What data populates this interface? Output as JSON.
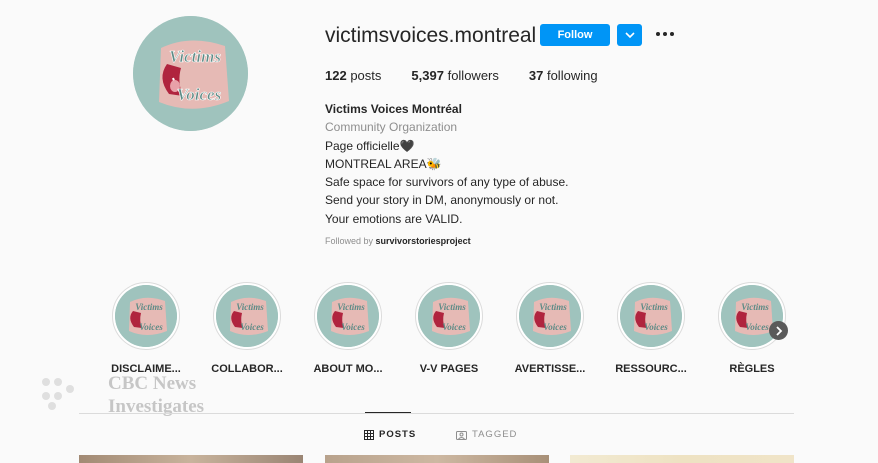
{
  "profile": {
    "username": "victimsvoices.montreal",
    "follow_label": "Follow",
    "avatar_text_top": "Victims",
    "avatar_text_bottom": "Voices",
    "stats": {
      "posts_count": "122",
      "posts_label": "posts",
      "followers_count": "5,397",
      "followers_label": "followers",
      "following_count": "37",
      "following_label": "following"
    },
    "bio": {
      "name": "Victims Voices Montréal",
      "category": "Community Organization",
      "lines": [
        "Page officielle🖤",
        "MONTREAL AREA🐝",
        "Safe space for survivors of any type of abuse.",
        "Send your story in DM, anonymously or not.",
        "Your emotions are VALID."
      ]
    },
    "followed_by_prefix": "Followed by",
    "followed_by_user": "survivorstoriesproject"
  },
  "highlights": [
    {
      "label": "DISCLAIME..."
    },
    {
      "label": "COLLABOR..."
    },
    {
      "label": "ABOUT MO..."
    },
    {
      "label": "V-V PAGES"
    },
    {
      "label": "AVERTISSE..."
    },
    {
      "label": "RESSOURC..."
    },
    {
      "label": "RÈGLES"
    }
  ],
  "tabs": {
    "posts": "POSTS",
    "tagged": "TAGGED"
  },
  "watermark": {
    "line1": "CBC News",
    "line2": "Investigates"
  },
  "colors": {
    "accent": "#0095f6",
    "avatar_bg": "#9fc3bd",
    "avatar_pink": "#f2b8b4"
  },
  "icons": [
    "chevron-down-icon",
    "more-icon",
    "chevron-right-icon",
    "grid-icon",
    "tag-icon"
  ]
}
